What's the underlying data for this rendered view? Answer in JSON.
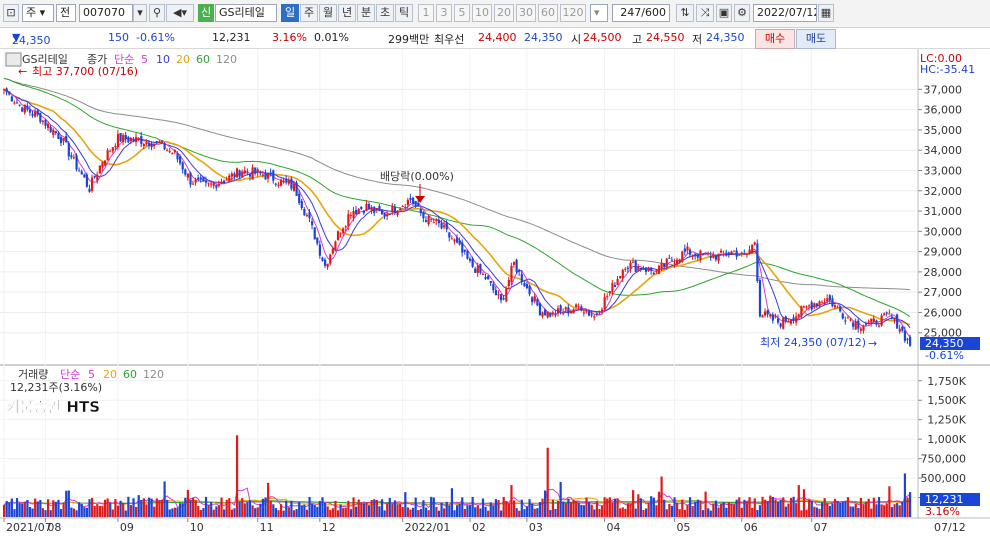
{
  "toolbar": {
    "period_select": "주",
    "prev_label": "전",
    "code": "007070",
    "name_badge": "신",
    "stock_name": "GS리테일",
    "intervals": [
      "일",
      "주",
      "월",
      "년",
      "분",
      "초",
      "틱"
    ],
    "active_interval": "일",
    "nums": [
      "1",
      "3",
      "5",
      "10",
      "20",
      "30",
      "60",
      "120"
    ],
    "count": "247/600",
    "date": "2022/07/12"
  },
  "info": {
    "price": "24,350",
    "change": "150",
    "change_pct": "-0.61%",
    "volume": "12,231",
    "turnover": "3.16%",
    "ratio": "0.01%",
    "amount": "299백만",
    "best_label": "최우선",
    "bid1": "24,400",
    "bid2": "24,350",
    "open_label": "시",
    "open": "24,500",
    "high_label": "고",
    "high": "24,550",
    "low_label": "저",
    "low": "24,350",
    "buy_label": "매수",
    "sell_label": "매도"
  },
  "chart_labels": {
    "name": "GS리테일",
    "legend_price": "종가",
    "legend_ma": "단순",
    "ma_periods": [
      "5",
      "10",
      "20",
      "60",
      "120"
    ],
    "max_label": "최고 37,700 (07/16)",
    "min_label": "최저 24,350 (07/12)",
    "dividend_label": "배당락(0.00%)",
    "lc": "LC:0.00",
    "hc": "HC:-35.41",
    "price_tag": "24,350",
    "price_tag_pct": "-0.61%",
    "vol_title": "거래량",
    "vol_ma": "단순",
    "vol_ma_periods": [
      "5",
      "20",
      "60",
      "120"
    ],
    "vol_current": "12,231주(3.16%)",
    "watermark": "키움증권 HTS",
    "vol_tag": "12,231",
    "vol_tag_pct": "3.16%"
  },
  "colors": {
    "up": "#e01a1a",
    "down": "#1a45d6",
    "ma5": "#d33cd3",
    "ma10": "#3a3ad8",
    "ma20": "#e8a40c",
    "ma60": "#2da52d",
    "ma120": "#8c8c8c"
  },
  "chart_data": {
    "type": "candlestick",
    "x_ticks": [
      "2021/07",
      "08",
      "09",
      "10",
      "11",
      "12",
      "2022/01",
      "02",
      "03",
      "04",
      "05",
      "06",
      "07"
    ],
    "x_end_label": "07/12",
    "price_ticks": [
      37000,
      36000,
      35000,
      34000,
      33000,
      32000,
      31000,
      30000,
      29000,
      28000,
      27000,
      26000,
      25000
    ],
    "volume_ticks": [
      "1,750K",
      "1,500K",
      "1,250K",
      "1,000K",
      "750,000",
      "500,000",
      "250,000"
    ],
    "price_range": [
      24000,
      38300
    ],
    "volume_range": [
      0,
      1850000
    ],
    "close_path": [
      [
        0,
        37000
      ],
      [
        6,
        36200
      ],
      [
        14,
        35600
      ],
      [
        22,
        34600
      ],
      [
        28,
        33200
      ],
      [
        33,
        32100
      ],
      [
        38,
        33500
      ],
      [
        44,
        34600
      ],
      [
        52,
        34500
      ],
      [
        60,
        34300
      ],
      [
        66,
        33800
      ],
      [
        72,
        32500
      ],
      [
        78,
        32200
      ],
      [
        86,
        32600
      ],
      [
        92,
        33000
      ],
      [
        100,
        32800
      ],
      [
        106,
        32500
      ],
      [
        112,
        32200
      ],
      [
        118,
        30500
      ],
      [
        124,
        28300
      ],
      [
        128,
        29600
      ],
      [
        134,
        31000
      ],
      [
        140,
        31200
      ],
      [
        146,
        30800
      ],
      [
        152,
        31200
      ],
      [
        157,
        31600
      ],
      [
        162,
        30700
      ],
      [
        168,
        30300
      ],
      [
        174,
        29500
      ],
      [
        180,
        28400
      ],
      [
        186,
        27700
      ],
      [
        192,
        26500
      ],
      [
        197,
        28400
      ],
      [
        202,
        27200
      ],
      [
        207,
        26100
      ],
      [
        212,
        25900
      ],
      [
        218,
        26100
      ],
      [
        223,
        26300
      ],
      [
        228,
        25800
      ],
      [
        234,
        27000
      ],
      [
        240,
        28400
      ],
      [
        246,
        28200
      ],
      [
        252,
        28000
      ],
      [
        258,
        28600
      ],
      [
        264,
        29000
      ],
      [
        270,
        28800
      ],
      [
        276,
        28800
      ],
      [
        282,
        29000
      ],
      [
        286,
        28700
      ],
      [
        290,
        29500
      ],
      [
        292,
        26000
      ],
      [
        296,
        25700
      ],
      [
        300,
        25500
      ],
      [
        306,
        25900
      ],
      [
        312,
        26400
      ],
      [
        318,
        26700
      ],
      [
        324,
        25900
      ],
      [
        330,
        25400
      ],
      [
        336,
        25500
      ],
      [
        342,
        25800
      ],
      [
        346,
        25300
      ],
      [
        350,
        24350
      ]
    ],
    "annotations": {
      "high": 37700,
      "low": 24350
    }
  }
}
